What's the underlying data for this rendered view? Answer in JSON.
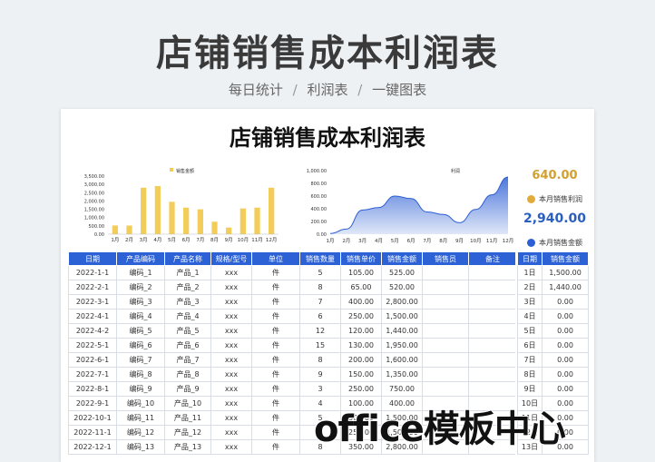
{
  "hero": {
    "title": "店铺销售成本利润表",
    "sub_1": "每日统计",
    "sub_sep": "/",
    "sub_2": "利润表",
    "sub_3": "一键图表"
  },
  "sheet": {
    "title": "店铺销售成本利润表"
  },
  "chart_data": [
    {
      "type": "bar",
      "legend": "销售金额",
      "categories": [
        "1月",
        "2月",
        "3月",
        "4月",
        "5月",
        "6月",
        "7月",
        "8月",
        "9月",
        "10月",
        "11月",
        "12月"
      ],
      "values": [
        525,
        520,
        2800,
        2900,
        1950,
        1600,
        1500,
        750,
        400,
        1550,
        1600,
        2800
      ],
      "yticks": [
        "3,500.00",
        "3,000.00",
        "2,500.00",
        "2,000.00",
        "1,500.00",
        "1,000.00",
        "500.00",
        "0.00"
      ],
      "ylim": [
        0,
        3500
      ],
      "color": "#f3cd5a"
    },
    {
      "type": "area",
      "legend": "利润",
      "categories": [
        "1月",
        "2月",
        "3月",
        "4月",
        "5月",
        "6月",
        "7月",
        "8月",
        "9月",
        "10月",
        "11月",
        "12月"
      ],
      "values": [
        10,
        80,
        380,
        420,
        600,
        560,
        350,
        310,
        180,
        390,
        620,
        900
      ],
      "yticks": [
        "1,000.00",
        "800.00",
        "600.00",
        "400.00",
        "200.00",
        "0.00"
      ],
      "ylim": [
        0,
        1000
      ],
      "color": "#2d5fd4"
    }
  ],
  "side": {
    "profit_value": "640.00",
    "profit_label": "本月销售利润",
    "sales_value": "2,940.00",
    "sales_label": "本月销售金额",
    "profit_color": "#d2a030",
    "sales_color": "#2a5fc0"
  },
  "table": {
    "headers": [
      "日期",
      "产品编码",
      "产品名称",
      "规格/型号",
      "单位",
      "销售数量",
      "销售单价",
      "销售金额",
      "销售员",
      "备注"
    ],
    "rows": [
      [
        "2022-1-1",
        "编码_1",
        "产品_1",
        "xxx",
        "件",
        "5",
        "105.00",
        "525.00",
        "",
        ""
      ],
      [
        "2022-2-1",
        "编码_2",
        "产品_2",
        "xxx",
        "件",
        "8",
        "65.00",
        "520.00",
        "",
        ""
      ],
      [
        "2022-3-1",
        "编码_3",
        "产品_3",
        "xxx",
        "件",
        "7",
        "400.00",
        "2,800.00",
        "",
        ""
      ],
      [
        "2022-4-1",
        "编码_4",
        "产品_4",
        "xxx",
        "件",
        "6",
        "250.00",
        "1,500.00",
        "",
        ""
      ],
      [
        "2022-4-2",
        "编码_5",
        "产品_5",
        "xxx",
        "件",
        "12",
        "120.00",
        "1,440.00",
        "",
        ""
      ],
      [
        "2022-5-1",
        "编码_6",
        "产品_6",
        "xxx",
        "件",
        "15",
        "130.00",
        "1,950.00",
        "",
        ""
      ],
      [
        "2022-6-1",
        "编码_7",
        "产品_7",
        "xxx",
        "件",
        "8",
        "200.00",
        "1,600.00",
        "",
        ""
      ],
      [
        "2022-7-1",
        "编码_8",
        "产品_8",
        "xxx",
        "件",
        "9",
        "150.00",
        "1,350.00",
        "",
        ""
      ],
      [
        "2022-8-1",
        "编码_9",
        "产品_9",
        "xxx",
        "件",
        "3",
        "250.00",
        "750.00",
        "",
        ""
      ],
      [
        "2022-9-1",
        "编码_10",
        "产品_10",
        "xxx",
        "件",
        "4",
        "100.00",
        "400.00",
        "",
        ""
      ],
      [
        "2022-10-1",
        "编码_11",
        "产品_11",
        "xxx",
        "件",
        "5",
        "300.00",
        "1,500.00",
        "",
        ""
      ],
      [
        "2022-11-1",
        "编码_12",
        "产品_12",
        "xxx",
        "件",
        "6",
        "250.00",
        "1,500.00",
        "",
        ""
      ],
      [
        "2022-12-1",
        "编码_13",
        "产品_13",
        "xxx",
        "件",
        "8",
        "350.00",
        "2,800.00",
        "",
        ""
      ]
    ]
  },
  "side_table": {
    "headers": [
      "日期",
      "销售金额"
    ],
    "rows": [
      [
        "1日",
        "1,500.00"
      ],
      [
        "2日",
        "1,440.00"
      ],
      [
        "3日",
        "0.00"
      ],
      [
        "4日",
        "0.00"
      ],
      [
        "5日",
        "0.00"
      ],
      [
        "6日",
        "0.00"
      ],
      [
        "7日",
        "0.00"
      ],
      [
        "8日",
        "0.00"
      ],
      [
        "9日",
        "0.00"
      ],
      [
        "10日",
        "0.00"
      ],
      [
        "11日",
        "0.00"
      ],
      [
        "12日",
        "0.00"
      ],
      [
        "13日",
        "0.00"
      ]
    ]
  },
  "watermark": "office模板中心"
}
